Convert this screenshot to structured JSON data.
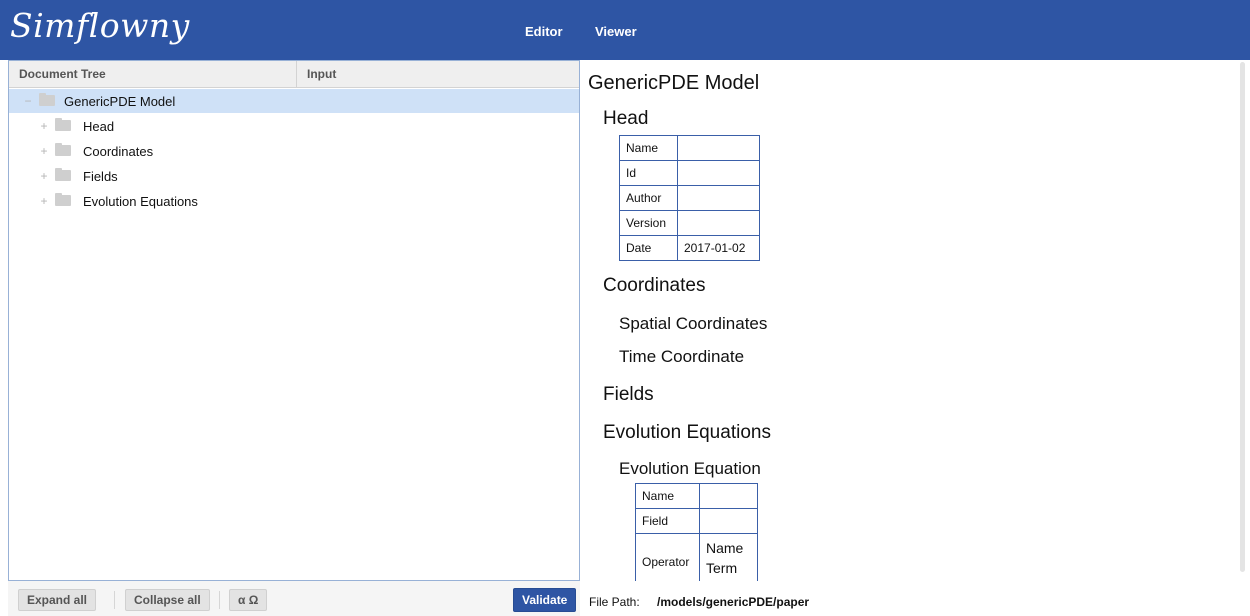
{
  "app": {
    "logo": "Simflowny",
    "nav": {
      "editor": "Editor",
      "viewer": "Viewer"
    }
  },
  "left": {
    "columns": {
      "tree": "Document Tree",
      "input": "Input"
    },
    "tree": [
      {
        "label": "GenericPDE Model",
        "expander": "−",
        "selected": true
      },
      {
        "label": "Head",
        "expander": "+"
      },
      {
        "label": "Coordinates",
        "expander": "+"
      },
      {
        "label": "Fields",
        "expander": "+"
      },
      {
        "label": "Evolution Equations",
        "expander": "+"
      }
    ],
    "toolbar": {
      "expand_all": "Expand all",
      "collapse_all": "Collapse all",
      "alpha_omega": "α Ω",
      "validate": "Validate"
    }
  },
  "viewer": {
    "title": "GenericPDE Model",
    "head": {
      "heading": "Head",
      "rows": [
        {
          "key": "Name",
          "value": ""
        },
        {
          "key": "Id",
          "value": ""
        },
        {
          "key": "Author",
          "value": ""
        },
        {
          "key": "Version",
          "value": ""
        },
        {
          "key": "Date",
          "value": "2017-01-02"
        }
      ]
    },
    "coordinates": {
      "heading": "Coordinates",
      "spatial": "Spatial Coordinates",
      "time": "Time Coordinate"
    },
    "fields": {
      "heading": "Fields"
    },
    "evolution": {
      "heading": "Evolution Equations",
      "sub": "Evolution Equation",
      "rows": [
        {
          "key": "Name",
          "value": ""
        },
        {
          "key": "Field",
          "value": ""
        },
        {
          "key": "Operator",
          "value_lines": [
            "Name",
            "Term"
          ]
        }
      ]
    },
    "file_path": {
      "label": "File Path:",
      "value": "/models/genericPDE/paper"
    }
  }
}
